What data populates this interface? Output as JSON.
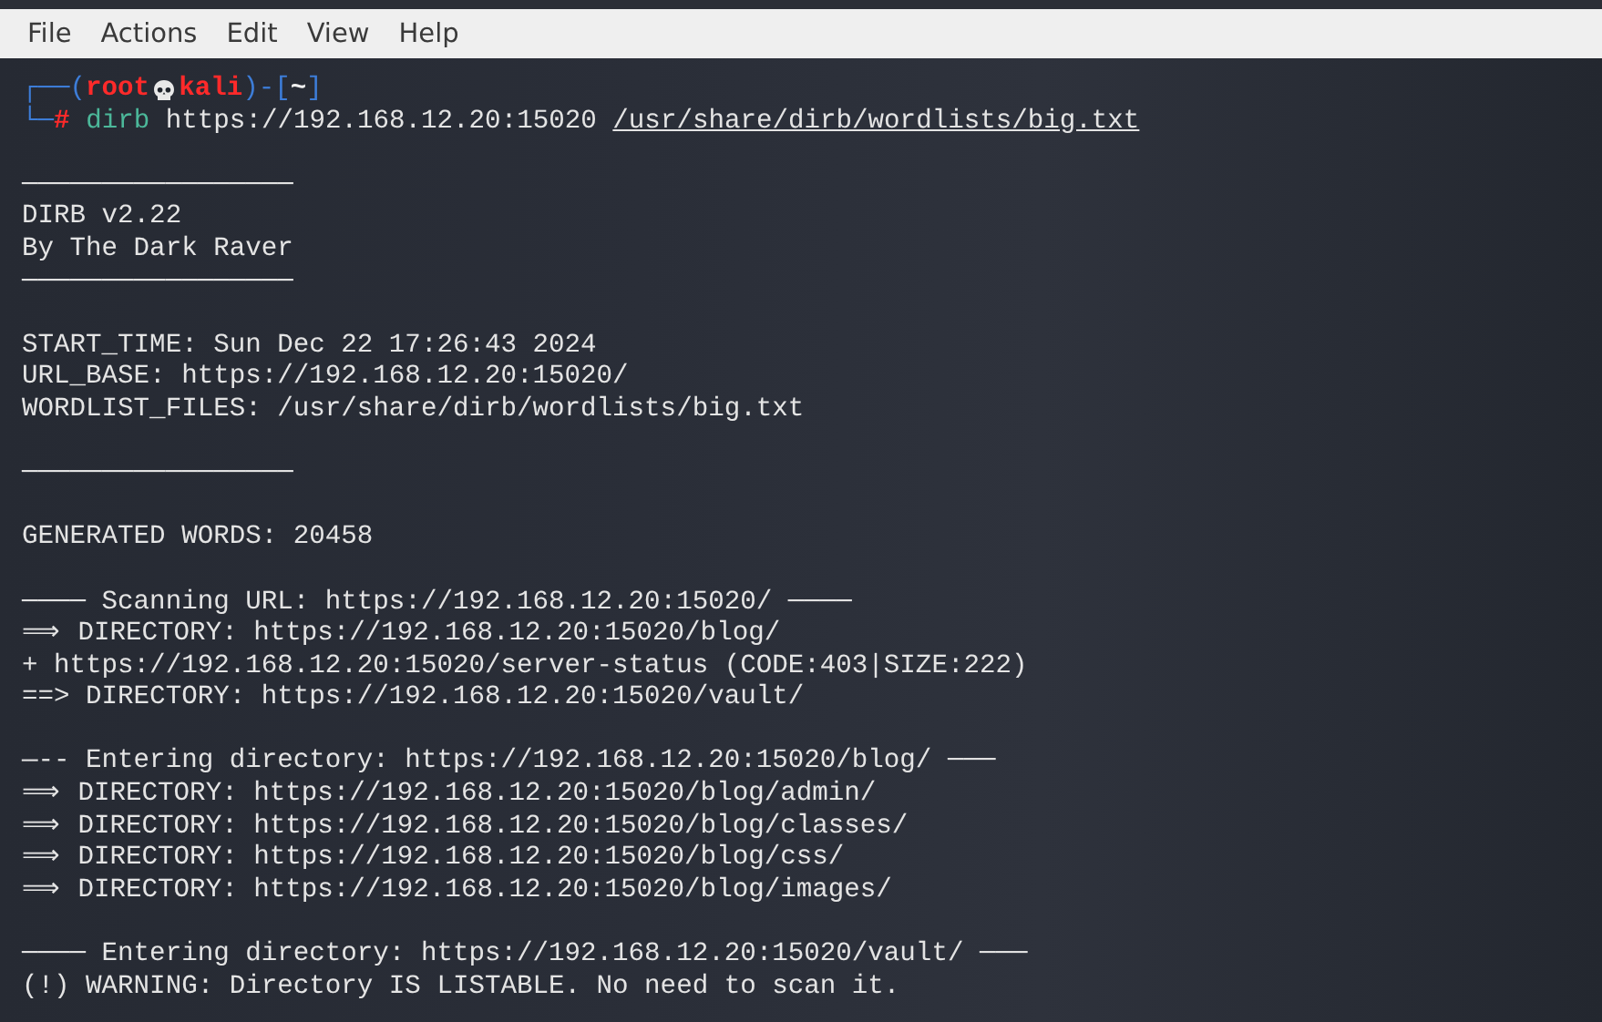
{
  "menu": [
    "File",
    "Actions",
    "Edit",
    "View",
    "Help"
  ],
  "prompt": {
    "line1": [
      {
        "kind": "frame",
        "text": "┌──("
      },
      {
        "kind": "user",
        "text": "root"
      },
      {
        "kind": "host",
        "text": "kali"
      },
      {
        "kind": "frame",
        "text": ")-["
      },
      {
        "kind": "dir",
        "text": "~"
      },
      {
        "kind": "frame",
        "text": "]"
      }
    ],
    "line2": [
      {
        "kind": "frame",
        "text": "└─"
      },
      {
        "kind": "symbol",
        "text": "#"
      },
      {
        "kind": "command",
        "text": "dirb"
      },
      {
        "kind": "arg",
        "text": "https://192.168.12.20:15020"
      },
      {
        "kind": "path",
        "text": "/usr/share/dirb/wordlists/big.txt"
      }
    ]
  },
  "output": [
    {
      "kind": "blank"
    },
    {
      "kind": "rule",
      "text": "─────────────────"
    },
    {
      "kind": "text",
      "text": "DIRB v2.22"
    },
    {
      "kind": "text",
      "text": "By The Dark Raver"
    },
    {
      "kind": "rule",
      "text": "─────────────────"
    },
    {
      "kind": "blank"
    },
    {
      "kind": "text",
      "text": "START_TIME: Sun Dec 22 17:26:43 2024"
    },
    {
      "kind": "text",
      "text": "URL_BASE: https://192.168.12.20:15020/"
    },
    {
      "kind": "text",
      "text": "WORDLIST_FILES: /usr/share/dirb/wordlists/big.txt"
    },
    {
      "kind": "blank"
    },
    {
      "kind": "rule",
      "text": "─────────────────"
    },
    {
      "kind": "blank"
    },
    {
      "kind": "text",
      "text": "GENERATED WORDS: 20458"
    },
    {
      "kind": "blank"
    },
    {
      "kind": "text",
      "text": "──── Scanning URL: https://192.168.12.20:15020/ ────"
    },
    {
      "kind": "text",
      "text": "⟹ DIRECTORY: https://192.168.12.20:15020/blog/"
    },
    {
      "kind": "text",
      "text": "+ https://192.168.12.20:15020/server-status (CODE:403|SIZE:222)"
    },
    {
      "kind": "text",
      "text": "==> DIRECTORY: https://192.168.12.20:15020/vault/"
    },
    {
      "kind": "blank"
    },
    {
      "kind": "text",
      "text": "—-- Entering directory: https://192.168.12.20:15020/blog/ ───"
    },
    {
      "kind": "text",
      "text": "⟹ DIRECTORY: https://192.168.12.20:15020/blog/admin/"
    },
    {
      "kind": "text",
      "text": "⟹ DIRECTORY: https://192.168.12.20:15020/blog/classes/"
    },
    {
      "kind": "text",
      "text": "⟹ DIRECTORY: https://192.168.12.20:15020/blog/css/"
    },
    {
      "kind": "text",
      "text": "⟹ DIRECTORY: https://192.168.12.20:15020/blog/images/"
    },
    {
      "kind": "blank"
    },
    {
      "kind": "text",
      "text": "──── Entering directory: https://192.168.12.20:15020/vault/ ───"
    },
    {
      "kind": "text",
      "text": "(!) WARNING: Directory IS LISTABLE. No need to scan it."
    }
  ]
}
